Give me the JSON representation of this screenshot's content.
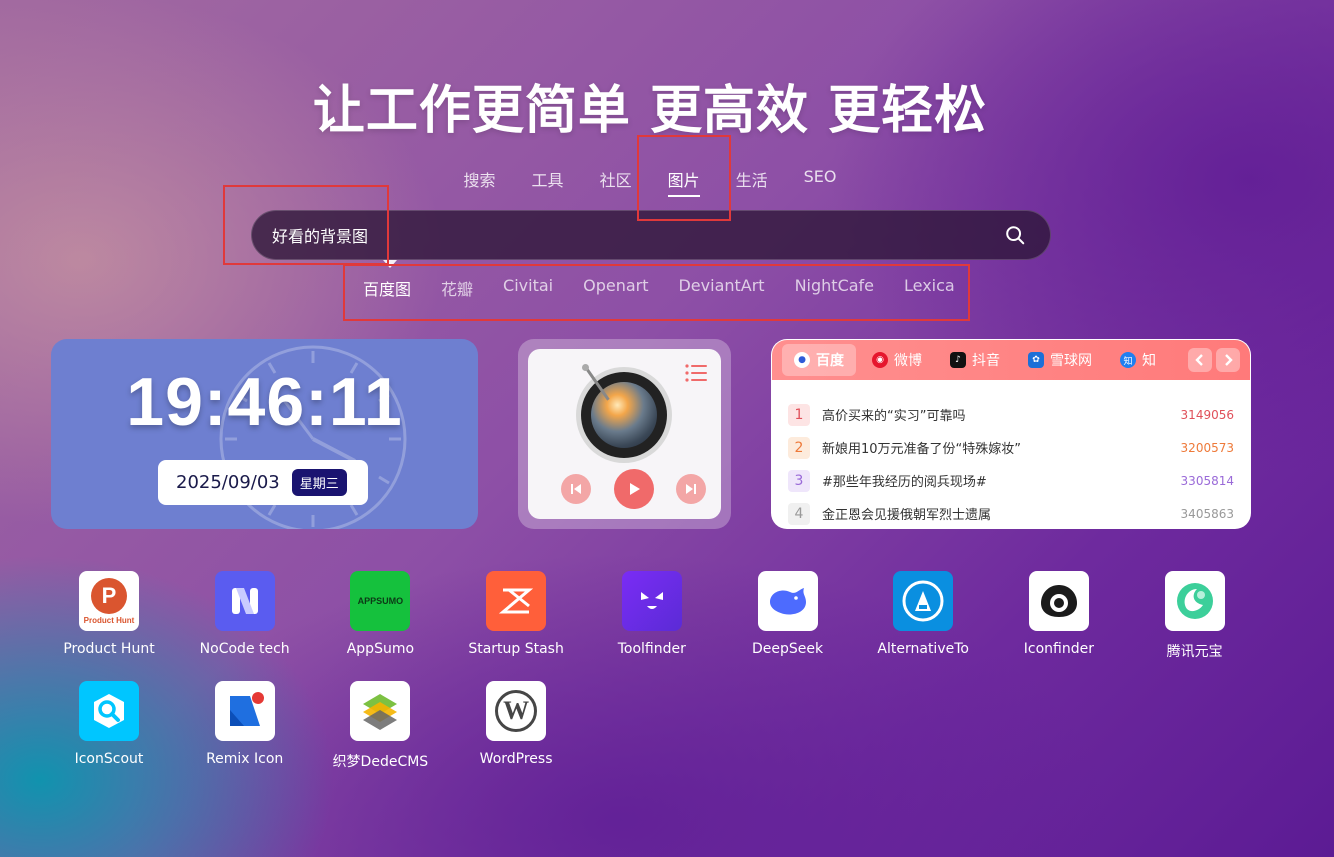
{
  "headline": "让工作更简单 更高效 更轻松",
  "category_tabs": [
    "搜索",
    "工具",
    "社区",
    "图片",
    "生活",
    "SEO"
  ],
  "active_category": "图片",
  "search": {
    "value": "好看的背景图",
    "placeholder": ""
  },
  "engines": [
    "百度图",
    "花瓣",
    "Civitai",
    "Openart",
    "DeviantArt",
    "NightCafe",
    "Lexica"
  ],
  "clock": {
    "time": "19:46:11",
    "date": "2025/09/03",
    "weekday": "星期三"
  },
  "hot": {
    "tabs": [
      {
        "label": "百度",
        "icon": "baidu-paw-icon"
      },
      {
        "label": "微博",
        "icon": "weibo-icon"
      },
      {
        "label": "抖音",
        "icon": "douyin-icon"
      },
      {
        "label": "雪球网",
        "icon": "xueqiu-icon"
      },
      {
        "label": "知",
        "icon": "zhihu-icon"
      }
    ],
    "items": [
      {
        "rank": "1",
        "title": "高价买来的“实习”可靠吗",
        "count": "3149056",
        "color": "#e0505a",
        "bg": "#fde4e4"
      },
      {
        "rank": "2",
        "title": "新娘用10万元准备了份“特殊嫁妆”",
        "count": "3200573",
        "color": "#ee7a3a",
        "bg": "#fdebdc"
      },
      {
        "rank": "3",
        "title": "#那些年我经历的阅兵现场#",
        "count": "3305814",
        "color": "#9a6ad8",
        "bg": "#efe6fb"
      },
      {
        "rank": "4",
        "title": "金正恩会见援俄朝军烈士遗属",
        "count": "3405863",
        "color": "#999999",
        "bg": "#f0f0f0"
      }
    ]
  },
  "apps": [
    {
      "label": "Product Hunt",
      "icon": "product-hunt-icon",
      "mark": "P",
      "sub": "Product Hunt"
    },
    {
      "label": "NoCode tech",
      "icon": "nocode-tech-icon",
      "mark": "N"
    },
    {
      "label": "AppSumo",
      "icon": "appsumo-icon",
      "mark": "APPSUMO"
    },
    {
      "label": "Startup Stash",
      "icon": "startup-stash-icon",
      "mark": "S"
    },
    {
      "label": "Toolfinder",
      "icon": "toolfinder-icon",
      "mark": ""
    },
    {
      "label": "DeepSeek",
      "icon": "deepseek-whale-icon",
      "mark": ""
    },
    {
      "label": "AlternativeTo",
      "icon": "alternativeto-icon",
      "mark": ""
    },
    {
      "label": "Iconfinder",
      "icon": "iconfinder-eye-icon",
      "mark": ""
    },
    {
      "label": "腾讯元宝",
      "icon": "tencent-yuanbao-icon",
      "mark": ""
    },
    {
      "label": "IconScout",
      "icon": "iconscout-icon",
      "mark": ""
    },
    {
      "label": "Remix Icon",
      "icon": "remix-icon-logo",
      "mark": ""
    },
    {
      "label": "织梦DedeCMS",
      "icon": "dedecms-icon",
      "mark": ""
    },
    {
      "label": "WordPress",
      "icon": "wordpress-icon",
      "mark": "W"
    }
  ]
}
